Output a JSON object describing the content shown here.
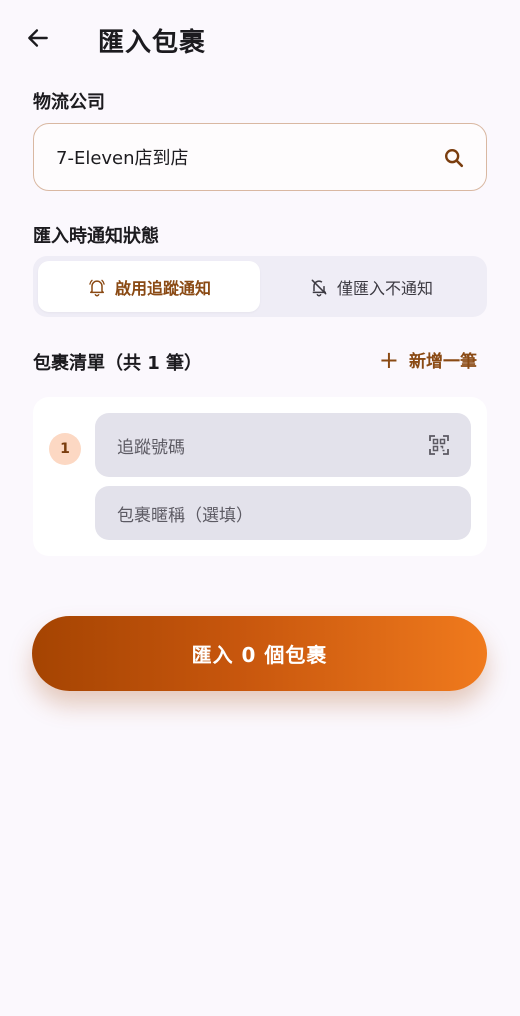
{
  "header": {
    "title": "匯入包裹",
    "back_icon": "arrow-left-icon"
  },
  "company": {
    "label": "物流公司",
    "value": "7-Eleven店到店",
    "search_icon": "search-icon"
  },
  "notify": {
    "label": "匯入時通知狀態",
    "options": [
      {
        "label": "啟用追蹤通知",
        "icon": "bell-icon",
        "selected": true
      },
      {
        "label": "僅匯入不通知",
        "icon": "bell-off-icon",
        "selected": false
      }
    ]
  },
  "packages": {
    "title": "包裹清單（共 1 筆）",
    "add_label": "新增一筆",
    "add_icon": "plus-icon",
    "items": [
      {
        "index": "1",
        "tracking_placeholder": "追蹤號碼",
        "nickname_placeholder": "包裹暱稱（選填）",
        "scan_icon": "qr-scan-icon"
      }
    ]
  },
  "submit": {
    "label": "匯入 0 個包裹"
  },
  "colors": {
    "accent": "#8a4a14",
    "button_start": "#a54402",
    "button_end": "#f07a1d",
    "background": "#fbf8fd"
  }
}
